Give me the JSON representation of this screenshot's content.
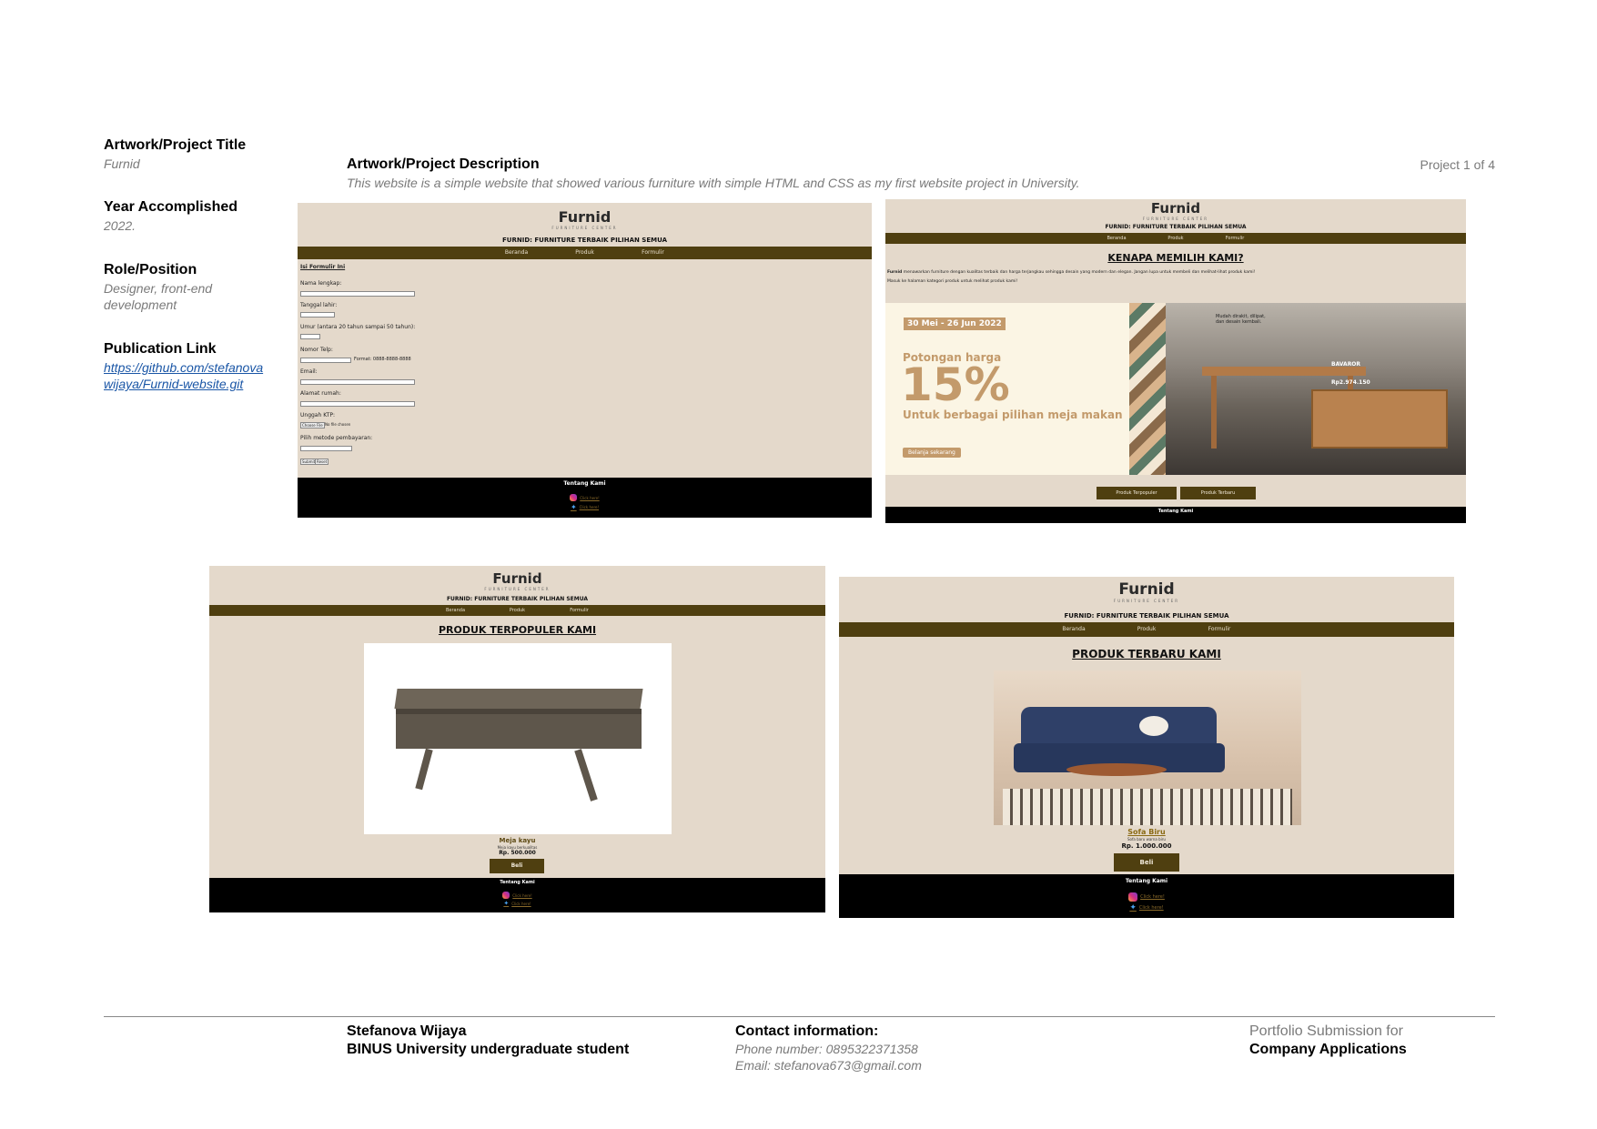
{
  "left": {
    "title_label": "Artwork/Project Title",
    "title_value": "Furnid",
    "year_label": "Year Accomplished",
    "year_value": "2022.",
    "role_label": "Role/Position",
    "role_value": "Designer, front-end development",
    "link_label": "Publication Link",
    "link_value": "https://github.com/stefanovawijaya/Furnid-website.git"
  },
  "description": {
    "label": "Artwork/Project Description",
    "text": "This website is a simple website that showed various furniture with simple HTML and CSS as my first website project in University.",
    "counter": "Project 1 of 4"
  },
  "site": {
    "logo": "Furnid",
    "logo_sub": "FURNITURE CENTER",
    "tagline": "FURNID: FURNITURE TERBAIK PILIHAN SEMUA",
    "nav": [
      "Beranda",
      "Produk",
      "Formulir"
    ],
    "footer_title": "Tentang Kami",
    "social_label": "Click here!"
  },
  "form_page": {
    "heading": "Isi Formulir Ini",
    "fields": [
      "Nama lengkap:",
      "Tanggal lahir:",
      "Umur (antara 20 tahun sampai 50 tahun):",
      "Nomor Telp:",
      "Email:",
      "Alamat rumah:",
      "Unggah KTP:",
      "Pilih metode pembayaran:"
    ],
    "phone_hint": "Format: 0888-8888-8888",
    "submit": "Submit",
    "reset": "Reset",
    "file_btn": "Choose File",
    "file_none": "No file chosen"
  },
  "home_page": {
    "heading": "KENAPA MEMILIH KAMI?",
    "line1_strong": "Furnid",
    "line1": "menawarkan furniture dengan kualitas terbaik dan harga terjangkau sehingga desain yang modern dan elegan. Jangan lupa untuk membeli dan melihat-lihat produk kami!",
    "line2": "Masuk ke halaman kategori produk untuk melihat produk kami!",
    "promo_date": "30 Mei - 26 Jun 2022",
    "promo_line1": "Potongan harga",
    "promo_pct": "15%",
    "promo_line2": "Untuk berbagai pilihan meja makan",
    "promo_cta": "Belanja sekarang",
    "promo_note": "Mudah dirakit, dilipat, dan desain kembali.",
    "promo_price_name": "BAVAROR",
    "promo_price": "Rp2.974.150",
    "btn_populer": "Produk Terpopuler",
    "btn_terbaru": "Produk Terbaru"
  },
  "popular_page": {
    "heading": "PRODUK TERPOPULER KAMI",
    "product_name": "Meja kayu",
    "product_desc": "Meja kayu berkualitas",
    "product_price": "Rp. 500.000",
    "buy": "Beli"
  },
  "newest_page": {
    "heading": "PRODUK TERBARU KAMI",
    "product_name": "Sofa Biru",
    "product_desc": "Sofa baru warna biru",
    "product_price": "Rp. 1.000.000",
    "buy": "Beli"
  },
  "footer": {
    "name": "Stefanova Wijaya",
    "school": "BINUS University undergraduate student",
    "contact_label": "Contact information:",
    "phone": "Phone number: 0895322371358",
    "email": "Email: stefanova673@gmail.com",
    "portfolio_line1": "Portfolio Submission for",
    "portfolio_line2": "Company Applications"
  },
  "colors": {
    "site_bg": "#e4d9cb",
    "nav_brown": "#4f3f10",
    "link_blue": "#1a56a6",
    "meta_grey": "#7a7a7a"
  }
}
